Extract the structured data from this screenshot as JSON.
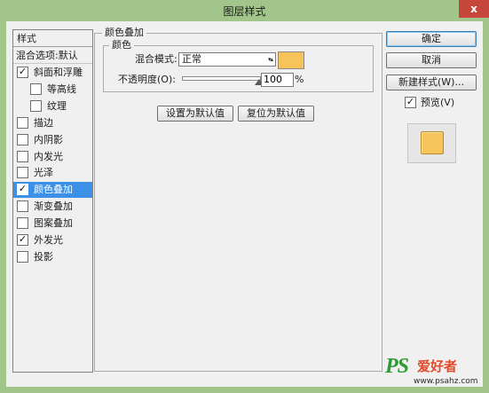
{
  "window": {
    "title": "图层样式",
    "close_glyph": "x"
  },
  "style_list": {
    "header": "样式",
    "blend_options": "混合选项:默认",
    "items": [
      {
        "label": "斜面和浮雕",
        "checked": true,
        "sub": false,
        "selected": false
      },
      {
        "label": "等高线",
        "checked": false,
        "sub": true,
        "selected": false
      },
      {
        "label": "纹理",
        "checked": false,
        "sub": true,
        "selected": false
      },
      {
        "label": "描边",
        "checked": false,
        "sub": false,
        "selected": false
      },
      {
        "label": "内阴影",
        "checked": false,
        "sub": false,
        "selected": false
      },
      {
        "label": "内发光",
        "checked": false,
        "sub": false,
        "selected": false
      },
      {
        "label": "光泽",
        "checked": false,
        "sub": false,
        "selected": false
      },
      {
        "label": "颜色叠加",
        "checked": true,
        "sub": false,
        "selected": true
      },
      {
        "label": "渐变叠加",
        "checked": false,
        "sub": false,
        "selected": false
      },
      {
        "label": "图案叠加",
        "checked": false,
        "sub": false,
        "selected": false
      },
      {
        "label": "外发光",
        "checked": true,
        "sub": false,
        "selected": false
      },
      {
        "label": "投影",
        "checked": false,
        "sub": false,
        "selected": false
      }
    ]
  },
  "color_overlay": {
    "section_title": "颜色叠加",
    "group_title": "颜色",
    "blend_mode_label": "混合模式:",
    "blend_mode_value": "正常",
    "color": "#f6c45b",
    "opacity_label": "不透明度(O):",
    "opacity_value": "100",
    "opacity_unit": "%",
    "opacity_fraction": 1.0,
    "set_default_button": "设置为默认值",
    "reset_default_button": "复位为默认值"
  },
  "actions": {
    "ok": "确定",
    "cancel": "取消",
    "new_style": "新建样式(W)...",
    "preview_label": "预览(V)",
    "preview_checked": true
  },
  "preview": {
    "swatch_color": "#f6c45b"
  },
  "watermark": {
    "logo": "PS",
    "text": "爱好者",
    "url": "www.psahz.com"
  },
  "colors": {
    "background": "#a2c58b",
    "dialog": "#f0f0f0",
    "selection": "#3c91e6",
    "close_button": "#c7463c"
  },
  "icons": {
    "close": "close-icon",
    "checkbox": "checkmark-icon",
    "dropdown": "chevron-down-icon",
    "slider": "slider-thumb-icon"
  }
}
